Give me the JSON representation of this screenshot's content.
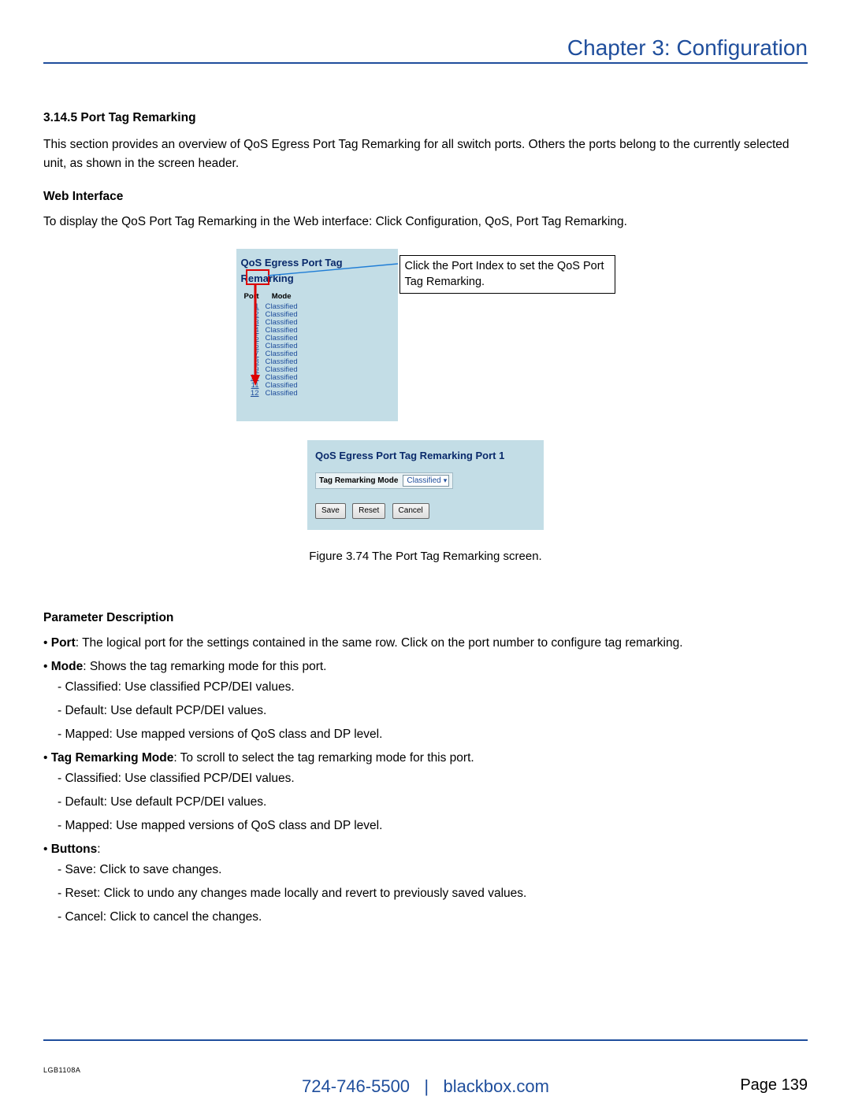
{
  "header": {
    "title": "Chapter 3: Configuration"
  },
  "section": {
    "number_title": "3.14.5 Port Tag Remarking",
    "intro": "This section provides an overview of QoS Egress Port Tag Remarking for all switch ports. Others the ports belong to the currently selected unit, as shown in the screen header.",
    "web_interface_heading": "Web Interface",
    "web_interface_text": "To display the QoS Port Tag Remarking in the Web interface: Click Configuration, QoS, Port Tag Remarking."
  },
  "figure": {
    "panel_a_title": "QoS Egress Port Tag Remarking",
    "table_headers": {
      "port": "Port",
      "mode": "Mode"
    },
    "rows": [
      {
        "port": "1",
        "mode": "Classified"
      },
      {
        "port": "2",
        "mode": "Classified"
      },
      {
        "port": "3",
        "mode": "Classified"
      },
      {
        "port": "4",
        "mode": "Classified"
      },
      {
        "port": "5",
        "mode": "Classified"
      },
      {
        "port": "6",
        "mode": "Classified"
      },
      {
        "port": "7",
        "mode": "Classified"
      },
      {
        "port": "8",
        "mode": "Classified"
      },
      {
        "port": "9",
        "mode": "Classified"
      },
      {
        "port": "10",
        "mode": "Classified"
      },
      {
        "port": "11",
        "mode": "Classified"
      },
      {
        "port": "12",
        "mode": "Classified"
      }
    ],
    "callout": "Click the Port Index to set the QoS Port Tag Remarking.",
    "panel_b_title": "QoS Egress Port Tag Remarking  Port 1",
    "mode_label": "Tag Remarking Mode",
    "mode_value": "Classified",
    "buttons": {
      "save": "Save",
      "reset": "Reset",
      "cancel": "Cancel"
    },
    "caption": "Figure 3.74 The Port Tag Remarking screen."
  },
  "params": {
    "heading": "Parameter Description",
    "port_label": "Port",
    "port_text": ": The logical port for the settings contained in the same row. Click on the port number to configure tag remarking.",
    "mode_label": "Mode",
    "mode_text": ": Shows the tag remarking mode for this port.",
    "mode_sub": [
      "Classified: Use classified PCP/DEI values.",
      "Default: Use default PCP/DEI values.",
      "Mapped: Use mapped versions of QoS class and DP level."
    ],
    "trm_label": "Tag Remarking Mode",
    "trm_text": ": To scroll to select the tag remarking mode for this port.",
    "trm_sub": [
      "Classified: Use classified PCP/DEI values.",
      "Default: Use default PCP/DEI values.",
      "Mapped: Use mapped versions of QoS class and DP level."
    ],
    "buttons_label": "Buttons",
    "buttons_colon": ":",
    "buttons_sub": [
      "Save: Click to save changes.",
      "Reset: Click to undo any changes made locally and revert to previously saved values.",
      "Cancel: Click to cancel the changes."
    ]
  },
  "footer": {
    "model": "LGB1108A",
    "phone": "724-746-5500",
    "sep": "|",
    "site": "blackbox.com",
    "page_label": "Page",
    "page_number": "139"
  }
}
